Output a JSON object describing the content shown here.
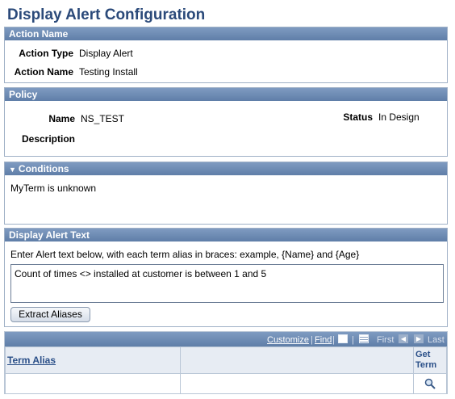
{
  "page_title": "Display Alert Configuration",
  "action_section": {
    "header": "Action Name",
    "action_type_label": "Action Type",
    "action_type_value": "Display Alert",
    "action_name_label": "Action Name",
    "action_name_value": "Testing Install"
  },
  "policy_section": {
    "header": "Policy",
    "name_label": "Name",
    "name_value": "NS_TEST",
    "status_label": "Status",
    "status_value": "In Design",
    "description_label": "Description",
    "description_value": ""
  },
  "conditions_section": {
    "header": "Conditions",
    "text": "MyTerm is unknown"
  },
  "alert_text_section": {
    "header": "Display Alert Text",
    "instruction": "Enter Alert text below, with each term alias in braces: example, {Name} and {Age}",
    "textarea_value": "Count of times <> installed at customer is between 1 and 5",
    "extract_button": "Extract Aliases"
  },
  "grid": {
    "customize": "Customize",
    "find": "Find",
    "first": "First",
    "last": "Last",
    "col_term_alias": "Term Alias",
    "col_get_term": "Get Term"
  },
  "colors": {
    "header_bg": "#5f7ea8",
    "title": "#2b4a7a",
    "link": "#2a4f88"
  },
  "icons": [
    "view-all-icon",
    "spreadsheet-icon",
    "prev-arrow-icon",
    "next-arrow-icon",
    "lookup-icon",
    "collapse-triangle-icon"
  ]
}
